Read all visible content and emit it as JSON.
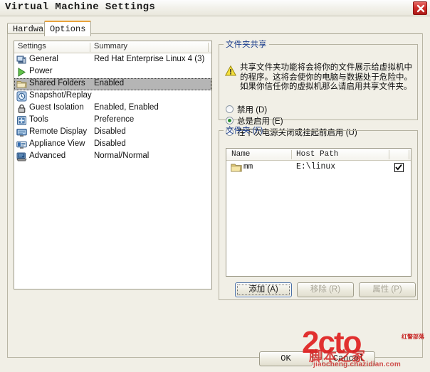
{
  "window": {
    "title": "Virtual Machine Settings",
    "close_icon": "close-icon"
  },
  "tabs": [
    {
      "label": "Hardware",
      "active": false
    },
    {
      "label": "Options",
      "active": true
    }
  ],
  "settings_list": {
    "columns": [
      "Settings",
      "Summary"
    ],
    "rows": [
      {
        "icon": "computer-icon",
        "name": "General",
        "summary": "Red Hat Enterprise Linux 4 (3)",
        "selected": false
      },
      {
        "icon": "play-icon",
        "name": "Power",
        "summary": "",
        "selected": false
      },
      {
        "icon": "folder-icon",
        "name": "Shared Folders",
        "summary": "Enabled",
        "selected": true
      },
      {
        "icon": "clock-icon",
        "name": "Snapshot/Replay",
        "summary": "",
        "selected": false
      },
      {
        "icon": "lock-icon",
        "name": "Guest Isolation",
        "summary": "Enabled, Enabled",
        "selected": false
      },
      {
        "icon": "tools-icon",
        "name": "Tools",
        "summary": "Preference",
        "selected": false
      },
      {
        "icon": "remote-display-icon",
        "name": "Remote Display",
        "summary": "Disabled",
        "selected": false
      },
      {
        "icon": "appliance-icon",
        "name": "Appliance View",
        "summary": "Disabled",
        "selected": false
      },
      {
        "icon": "advanced-icon",
        "name": "Advanced",
        "summary": "Normal/Normal",
        "selected": false
      }
    ]
  },
  "share_group": {
    "legend": "文件夹共享",
    "warning_icon": "warning-icon",
    "warning_text": "共享文件夹功能将会将你的文件展示给虚拟机中的程序。这将会使你的电脑与数据处于危险中。如果你信任你的虚拟机那么请启用共享文件夹。",
    "options": [
      {
        "label": "禁用 (D)",
        "checked": false
      },
      {
        "label": "总是启用 (E)",
        "checked": true
      },
      {
        "label": "在下次电源关闭或挂起前启用 (U)",
        "checked": false
      }
    ]
  },
  "folders_group": {
    "legend": "文件夹 (F)",
    "columns": [
      "Name",
      "Host Path"
    ],
    "rows": [
      {
        "icon": "folder-icon",
        "name": "mm",
        "host_path": "E:\\linux",
        "enabled": true
      }
    ],
    "buttons": [
      {
        "label": "添加 (A)",
        "disabled": false,
        "focused": true
      },
      {
        "label": "移除 (R)",
        "disabled": true,
        "focused": false
      },
      {
        "label": "属性 (P)",
        "disabled": true,
        "focused": false
      }
    ]
  },
  "dialog_buttons": [
    {
      "label": "OK"
    },
    {
      "label": "Cancel"
    }
  ],
  "watermark": {
    "brand": "2cto",
    "chinese": "脚本之家",
    "url": "jiaocheng.chazidian.com",
    "small_text": "红警部落"
  },
  "colors": {
    "accent_tab": "#e8a33d",
    "close_button": "#cf2f2b",
    "legend_text": "#1d3f8c",
    "selection": "#b5b5b5",
    "radio_dot": "#2c8f32",
    "watermark": "#e02020"
  }
}
